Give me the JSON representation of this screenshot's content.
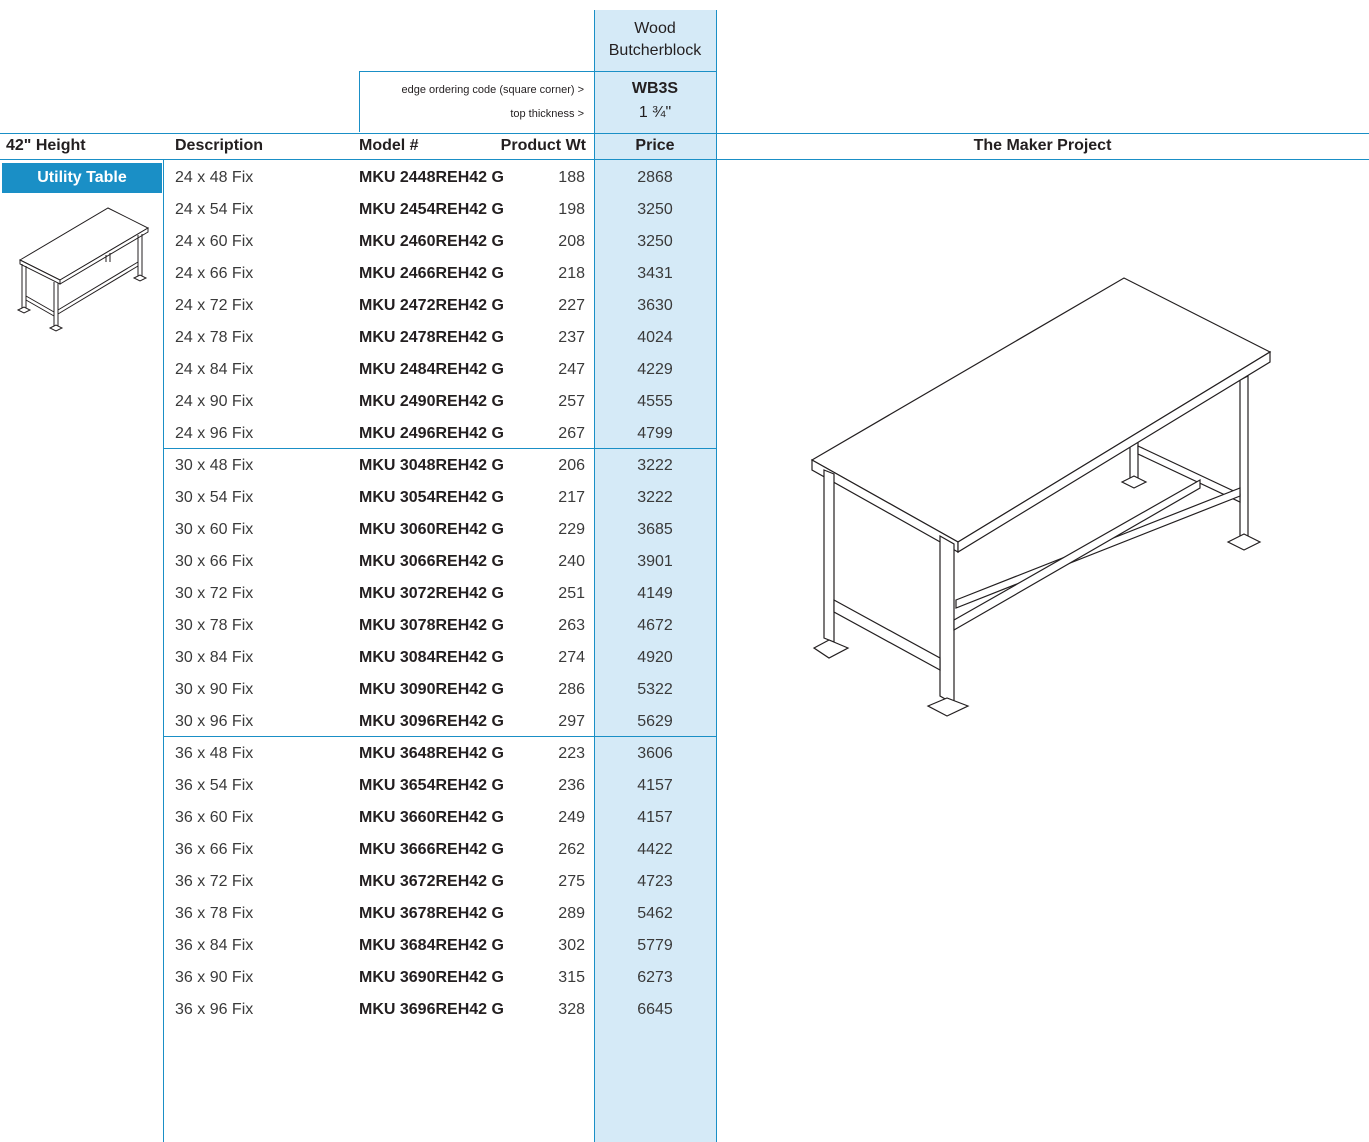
{
  "finish_header": {
    "line1": "Wood",
    "line2": "Butcherblock"
  },
  "edge_label": "edge ordering code (square corner) >",
  "thickness_label": "top thickness >",
  "edge_code": "WB3S",
  "thickness": "1 ¾\"",
  "columns": {
    "height": "42\" Height",
    "description": "Description",
    "model": "Model #",
    "weight": "Product Wt",
    "price": "Price",
    "project": "The Maker Project"
  },
  "category": "Utility Table",
  "icons": {
    "thumbnail": "utility-table-thumbnail-icon",
    "main": "utility-table-drawing-icon"
  },
  "colors": {
    "accent": "#1a8fc6",
    "price_column": "#d5eaf7"
  },
  "rows": [
    {
      "desc": "24 x 48 Fix",
      "model": "MKU 2448REH42 G",
      "wt": "188",
      "price": "2868"
    },
    {
      "desc": "24 x 54 Fix",
      "model": "MKU 2454REH42 G",
      "wt": "198",
      "price": "3250"
    },
    {
      "desc": "24 x 60 Fix",
      "model": "MKU 2460REH42 G",
      "wt": "208",
      "price": "3250"
    },
    {
      "desc": "24 x 66 Fix",
      "model": "MKU 2466REH42 G",
      "wt": "218",
      "price": "3431"
    },
    {
      "desc": "24 x 72 Fix",
      "model": "MKU 2472REH42 G",
      "wt": "227",
      "price": "3630"
    },
    {
      "desc": "24 x 78 Fix",
      "model": "MKU 2478REH42 G",
      "wt": "237",
      "price": "4024"
    },
    {
      "desc": "24 x 84 Fix",
      "model": "MKU 2484REH42 G",
      "wt": "247",
      "price": "4229"
    },
    {
      "desc": "24 x 90 Fix",
      "model": "MKU 2490REH42 G",
      "wt": "257",
      "price": "4555"
    },
    {
      "desc": "24 x 96 Fix",
      "model": "MKU 2496REH42 G",
      "wt": "267",
      "price": "4799"
    },
    {
      "desc": "30 x 48 Fix",
      "model": "MKU 3048REH42 G",
      "wt": "206",
      "price": "3222"
    },
    {
      "desc": "30 x 54 Fix",
      "model": "MKU 3054REH42 G",
      "wt": "217",
      "price": "3222"
    },
    {
      "desc": "30 x 60 Fix",
      "model": "MKU 3060REH42 G",
      "wt": "229",
      "price": "3685"
    },
    {
      "desc": "30 x 66 Fix",
      "model": "MKU 3066REH42 G",
      "wt": "240",
      "price": "3901"
    },
    {
      "desc": "30 x 72 Fix",
      "model": "MKU 3072REH42 G",
      "wt": "251",
      "price": "4149"
    },
    {
      "desc": "30 x 78 Fix",
      "model": "MKU 3078REH42 G",
      "wt": "263",
      "price": "4672"
    },
    {
      "desc": "30 x 84 Fix",
      "model": "MKU 3084REH42 G",
      "wt": "274",
      "price": "4920"
    },
    {
      "desc": "30 x 90 Fix",
      "model": "MKU 3090REH42 G",
      "wt": "286",
      "price": "5322"
    },
    {
      "desc": "30 x 96 Fix",
      "model": "MKU 3096REH42 G",
      "wt": "297",
      "price": "5629"
    },
    {
      "desc": "36 x 48 Fix",
      "model": "MKU 3648REH42 G",
      "wt": "223",
      "price": "3606"
    },
    {
      "desc": "36 x 54 Fix",
      "model": "MKU 3654REH42 G",
      "wt": "236",
      "price": "4157"
    },
    {
      "desc": "36 x 60 Fix",
      "model": "MKU 3660REH42 G",
      "wt": "249",
      "price": "4157"
    },
    {
      "desc": "36 x 66 Fix",
      "model": "MKU 3666REH42 G",
      "wt": "262",
      "price": "4422"
    },
    {
      "desc": "36 x 72 Fix",
      "model": "MKU 3672REH42 G",
      "wt": "275",
      "price": "4723"
    },
    {
      "desc": "36 x 78 Fix",
      "model": "MKU 3678REH42 G",
      "wt": "289",
      "price": "5462"
    },
    {
      "desc": "36 x 84 Fix",
      "model": "MKU 3684REH42 G",
      "wt": "302",
      "price": "5779"
    },
    {
      "desc": "36 x 90 Fix",
      "model": "MKU 3690REH42 G",
      "wt": "315",
      "price": "6273"
    },
    {
      "desc": "36 x 96 Fix",
      "model": "MKU 3696REH42 G",
      "wt": "328",
      "price": "6645"
    }
  ]
}
